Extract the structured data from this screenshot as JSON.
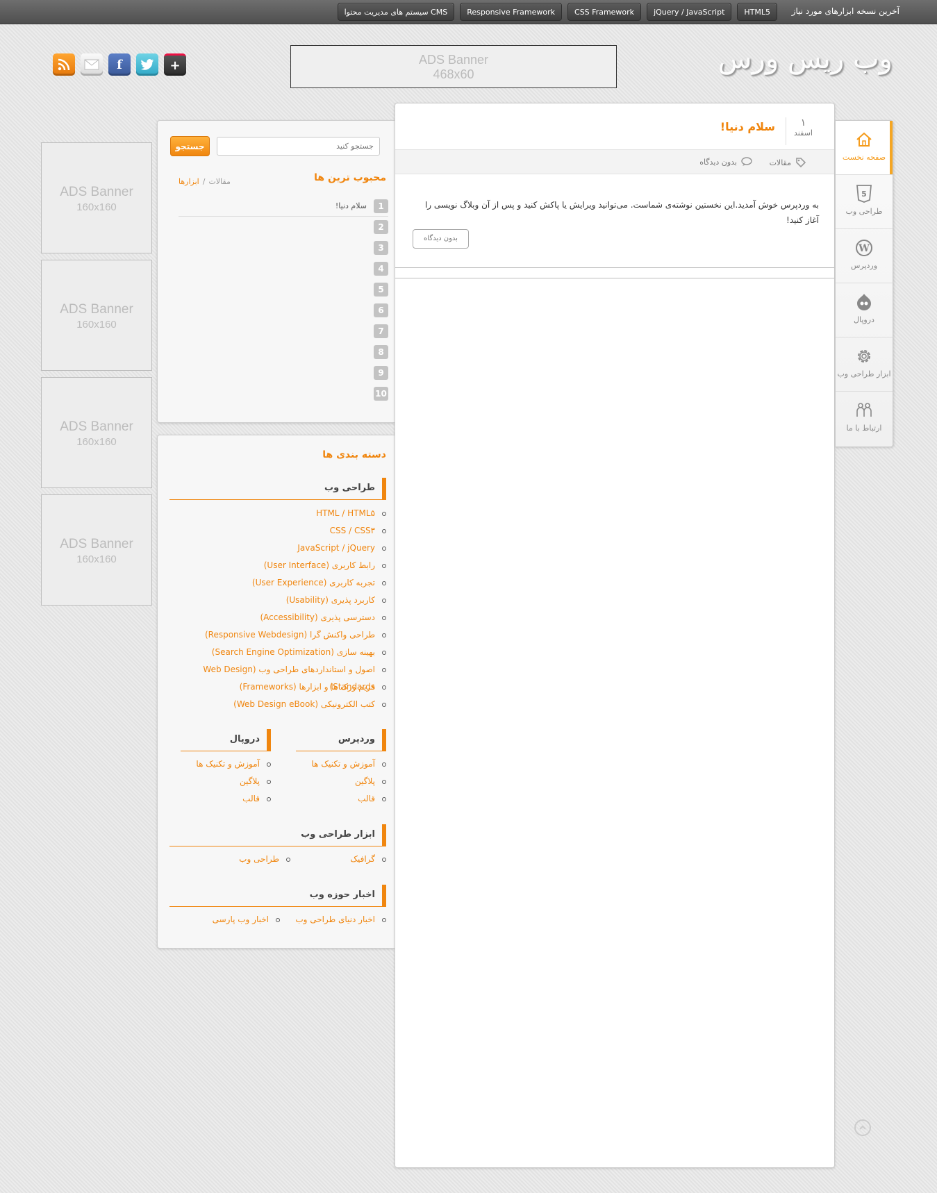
{
  "topbar": {
    "title": "آخرین نسخه ابزارهای مورد نیاز",
    "tags": [
      "HTML5",
      "jQuery / JavaScript",
      "CSS Framework",
      "Responsive Framework",
      "سیستم های مدیریت محتوا CMS"
    ]
  },
  "logo": {
    "text": "وب ریس ورس"
  },
  "header_ad": {
    "line1": "ADS Banner",
    "line2": "468x60"
  },
  "social": {
    "icons": [
      "rss-icon",
      "mail-icon",
      "facebook-icon",
      "twitter-icon",
      "google-plus-icon"
    ]
  },
  "side_ads": [
    {
      "line1": "ADS Banner",
      "line2": "160x160"
    },
    {
      "line1": "ADS Banner",
      "line2": "160x160"
    },
    {
      "line1": "ADS Banner",
      "line2": "160x160"
    },
    {
      "line1": "ADS Banner",
      "line2": "160x160"
    }
  ],
  "nav": {
    "items": [
      {
        "label": "صفحه نخست",
        "icon": "home-icon"
      },
      {
        "label": "طراحی وب",
        "icon": "html5-icon"
      },
      {
        "label": "وردپرس",
        "icon": "wordpress-icon"
      },
      {
        "label": "دروپال",
        "icon": "drupal-icon"
      },
      {
        "label": "ابزار طراحی وب",
        "icon": "gear-icon"
      },
      {
        "label": "ارتباط با ما",
        "icon": "users-icon"
      }
    ]
  },
  "search": {
    "placeholder": "جستجو کنید",
    "button": "جستجو"
  },
  "popular": {
    "title": "محبوب ترین ها",
    "tab_articles": "مقالات",
    "separator": "/",
    "tab_tools": "ابزارها",
    "items": [
      {
        "num": "1",
        "text": "سلام دنیا!"
      },
      {
        "num": "2",
        "text": ""
      },
      {
        "num": "3",
        "text": ""
      },
      {
        "num": "4",
        "text": ""
      },
      {
        "num": "5",
        "text": ""
      },
      {
        "num": "6",
        "text": ""
      },
      {
        "num": "7",
        "text": ""
      },
      {
        "num": "8",
        "text": ""
      },
      {
        "num": "9",
        "text": ""
      },
      {
        "num": "10",
        "text": ""
      }
    ]
  },
  "categories": {
    "title": "دسته بندی ها",
    "webdesign": {
      "title": "طراحی وب",
      "items": [
        "HTML / HTML۵",
        "CSS / CSS۳",
        "JavaScript / jQuery",
        "رابط کاربری (User Interface)",
        "تجربه کاربری (User Experience)",
        "کاربرد پذیری (Usability)",
        "دسترسی پذیری (Accessibility)",
        "طراحی واکنش گرا (Responsive Webdesign)",
        "بهینه سازی (Search Engine Optimization)",
        "اصول و استانداردهای طراحی وب (Web Design Standards)",
        "فریم ورک ها و ابزارها (Frameworks)",
        "کتب الکترونیکی (Web Design eBook)"
      ]
    },
    "wordpress": {
      "title": "وردپرس",
      "items": [
        "آموزش و تکنیک ها",
        "پلاگین",
        "قالب"
      ]
    },
    "drupal": {
      "title": "دروپال",
      "items": [
        "آموزش و تکنیک ها",
        "پلاگین",
        "قالب"
      ]
    },
    "tools": {
      "title": "ابزار طراحی وب",
      "items": [
        "گرافیک",
        "طراحی وب"
      ]
    },
    "news": {
      "title": "اخبار حوزه وب",
      "items": [
        "اخبار دنیای طراحی وب",
        "اخبار وب پارسی"
      ]
    }
  },
  "post": {
    "day": "۱",
    "month": "اسفند",
    "title": "سلام دنیا!",
    "category": "مقالات",
    "comments": "بدون دیدگاه",
    "body": "به وردپرس خوش آمدید.این نخستین نوشته‌ی شماست. می‌توانید ویرایش یا پاکش کنید و پس از آن وبلاگ نویسی را آغاز کنید!",
    "comment_button": "بدون دیدگاه"
  },
  "colors": {
    "accent": "#f0860f",
    "topbar": "#555555"
  }
}
